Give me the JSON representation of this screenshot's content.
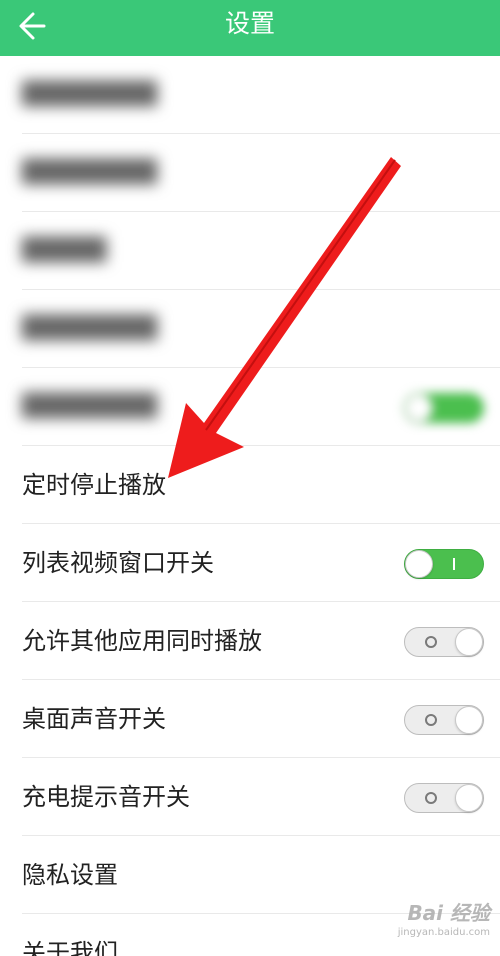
{
  "header": {
    "title": "设置",
    "back_icon": "arrow-left-icon"
  },
  "colors": {
    "accent": "#3ac878",
    "toggle_on": "#4bbf4e",
    "arrow": "#ee1c1c"
  },
  "rows": [
    {
      "label": "",
      "blurred": true
    },
    {
      "label": "",
      "blurred": true
    },
    {
      "label": "",
      "blurred": true
    },
    {
      "label": "",
      "blurred": true
    },
    {
      "label": "",
      "blurred": true,
      "toggle": "on"
    },
    {
      "label": "定时停止播放"
    },
    {
      "label": "列表视频窗口开关",
      "toggle": "on"
    },
    {
      "label": "允许其他应用同时播放",
      "toggle": "off"
    },
    {
      "label": "桌面声音开关",
      "toggle": "off"
    },
    {
      "label": "充电提示音开关",
      "toggle": "off"
    },
    {
      "label": "隐私设置"
    },
    {
      "label": "关于我们"
    }
  ],
  "watermark": {
    "top": "Bai 经验",
    "bottom": "jingyan.baidu.com"
  }
}
